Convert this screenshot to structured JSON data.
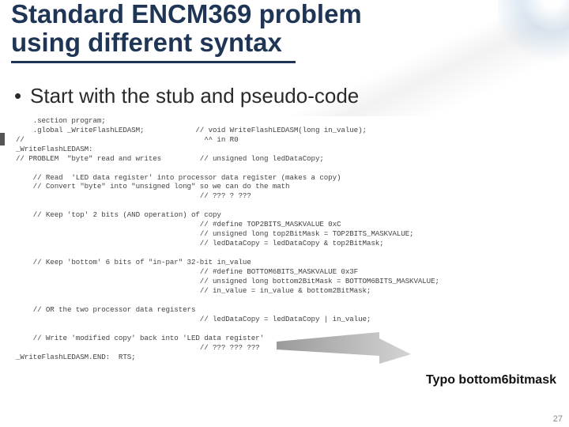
{
  "title_line1": "Standard ENCM369 problem",
  "title_line2": "using different syntax",
  "bullet1": "Start with the stub and pseudo-code",
  "code": "    .section program;\n    .global _WriteFlashLEDASM;            // void WriteFlashLEDASM(long in_value);\n//                                          ^^ in R0\n_WriteFlashLEDASM:\n// PROBLEM  \"byte\" read and writes         // unsigned long ledDataCopy;\n\n    // Read  'LED data register' into processor data register (makes a copy)\n    // Convert \"byte\" into \"unsigned long\" so we can do the math\n                                           // ??? ? ???\n\n    // Keep 'top' 2 bits (AND operation) of copy\n                                           // #define TOP2BITS_MASKVALUE 0xC\n                                           // unsigned long top2BitMask = TOP2BITS_MASKVALUE;\n                                           // ledDataCopy = ledDataCopy & top2BitMask;\n\n    // Keep 'bottom' 6 bits of \"in-par\" 32-bit in_value\n                                           // #define BOTTOM6BITS_MASKVALUE 0x3F\n                                           // unsigned long bottom2BitMask = BOTTOM6BITS_MASKVALUE;\n                                           // in_value = in_value & bottom2BitMask;\n\n    // OR the two processor data registers\n                                           // ledDataCopy = ledDataCopy | in_value;\n\n    // Write 'modified copy' back into 'LED data register'\n                                           // ??? ??? ???\n_WriteFlashLEDASM.END:  RTS;",
  "annotation": "Typo  bottom6bitmask",
  "slide_number": "27"
}
